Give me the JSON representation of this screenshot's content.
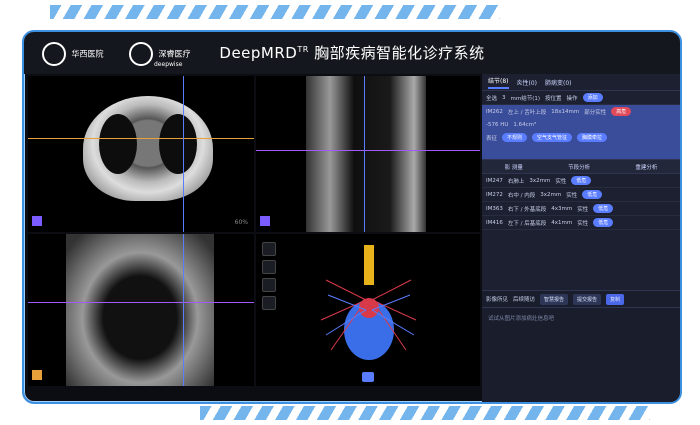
{
  "app": {
    "title_main": "DeepMRD",
    "title_sup": "TR",
    "title_rest": " 胸部疾病智能化诊疗系统"
  },
  "logos": {
    "hospital": "华西医院",
    "company": "深睿医疗",
    "company_en": "deepwise"
  },
  "viewer": {
    "zoom_label": "60%"
  },
  "panel": {
    "tabs": [
      {
        "label": "结节(8)"
      },
      {
        "label": "炎性(0)"
      },
      {
        "label": "肺病变(0)"
      }
    ],
    "filter": {
      "all": "全选",
      "count": "3",
      "size": "mm结节(1)",
      "mode": "按位置",
      "op": "操作",
      "button": "添加"
    },
    "selected": {
      "id": "IM262",
      "location": "左上 / 舌叶上段",
      "size": "18x14mm",
      "type": "部分实性",
      "badge": "高危",
      "density": "-576 HU",
      "volume": "1.64cm³",
      "tags_label": "表征",
      "tags": [
        "不规则",
        "空气支气管征",
        "胸膜牵拉"
      ]
    },
    "toolbar": [
      "影 测量",
      "节段分析",
      "重建分析"
    ],
    "rows": [
      {
        "id": "IM247",
        "loc": "右肺上",
        "size": "3x2mm",
        "type": "实性",
        "badge": "低危"
      },
      {
        "id": "IM272",
        "loc": "右中 / 内段",
        "size": "3x2mm",
        "type": "实性",
        "badge": "低危"
      },
      {
        "id": "IM363",
        "loc": "右下 / 外基底段",
        "size": "4x3mm",
        "type": "实性",
        "badge": "低危"
      },
      {
        "id": "IM416",
        "loc": "左下 / 后基底段",
        "size": "4x1mm",
        "type": "实性",
        "badge": "低危"
      }
    ],
    "report": {
      "label": "影像所见",
      "dropdown": "后续随访",
      "btn1": "智慧报告",
      "btn2": "提交报告",
      "btn3": "复制",
      "text": "试试从图片添加病灶信息吧"
    }
  }
}
